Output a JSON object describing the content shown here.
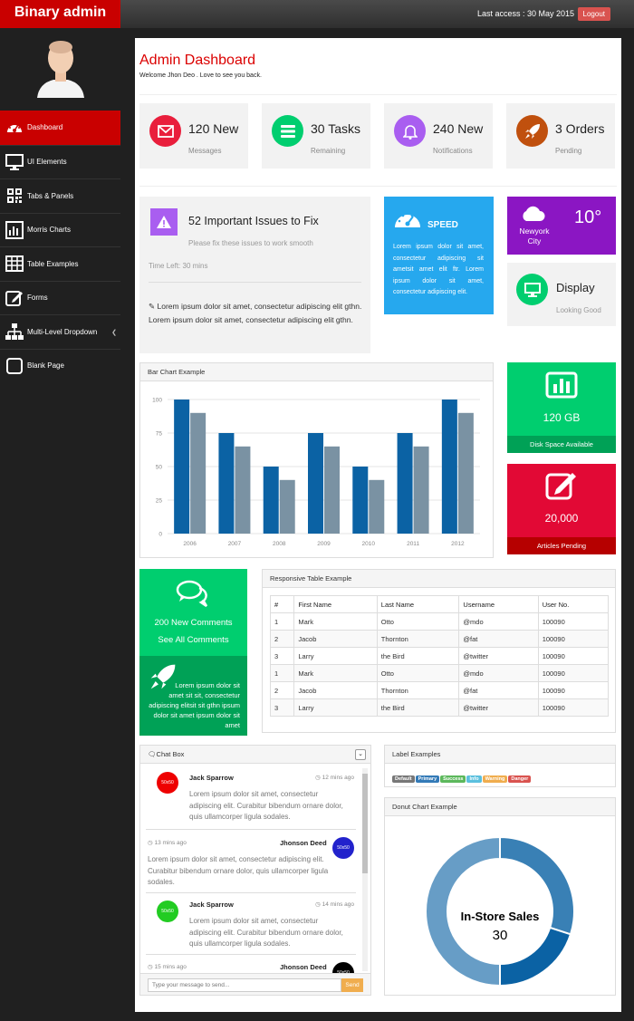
{
  "header": {
    "brand": "Binary admin",
    "last_access": "Last access : 30 May 2015",
    "logout_label": "Logout"
  },
  "sidebar": {
    "items": [
      {
        "label": "Dashboard",
        "icon": "dashboard-icon"
      },
      {
        "label": "UI Elements",
        "icon": "desktop-icon"
      },
      {
        "label": "Tabs & Panels",
        "icon": "qrcode-icon"
      },
      {
        "label": "Morris Charts",
        "icon": "bar-chart-icon"
      },
      {
        "label": "Table Examples",
        "icon": "table-icon"
      },
      {
        "label": "Forms",
        "icon": "edit-icon"
      },
      {
        "label": "Multi-Level Dropdown",
        "icon": "sitemap-icon"
      },
      {
        "label": "Blank Page",
        "icon": "square-icon"
      }
    ]
  },
  "page": {
    "title": "Admin Dashboard",
    "subtitle": "Welcome Jhon Deo . Love to see you back."
  },
  "stats": [
    {
      "value": "120 New",
      "label": "Messages",
      "color": "#e91e3c",
      "icon": "envelope-icon"
    },
    {
      "value": "30 Tasks",
      "label": "Remaining",
      "color": "#00ce6f",
      "icon": "bars-icon"
    },
    {
      "value": "240 New",
      "label": "Notifications",
      "color": "#a95ef0",
      "icon": "bell-icon"
    },
    {
      "value": "3 Orders",
      "label": "Pending",
      "color": "#c0500e",
      "icon": "rocket-icon"
    }
  ],
  "issues": {
    "title": "52 Important Issues to Fix",
    "subtitle": "Please fix these issues to work smooth",
    "time_left": "Time Left: 30 mins",
    "text": "Lorem ipsum dolor sit amet, consectetur adipiscing elit gthn. Lorem ipsum dolor sit amet, consectetur adipiscing elit gthn."
  },
  "speed": {
    "title": "SPEED",
    "text": "Lorem ipsum dolor sit amet, consectetur adipiscing sit ametsit amet elit ftr. Lorem ipsum dolor sit amet, consectetur adipiscing elit."
  },
  "weather": {
    "city": "Newyork City",
    "temp": "10°"
  },
  "display": {
    "title": "Display",
    "subtitle": "Looking Good"
  },
  "bar_panel": {
    "title": "Bar Chart Example"
  },
  "chart_data": {
    "type": "bar",
    "categories": [
      "2006",
      "2007",
      "2008",
      "2009",
      "2010",
      "2011",
      "2012"
    ],
    "series": [
      {
        "values": [
          100,
          75,
          50,
          75,
          50,
          75,
          100
        ],
        "color": "#0b62a4"
      },
      {
        "values": [
          90,
          65,
          40,
          65,
          40,
          65,
          90
        ],
        "color": "#7a92a3"
      }
    ],
    "yticks": [
      0,
      25,
      50,
      75,
      100
    ],
    "ylim": [
      0,
      100
    ],
    "grid": true
  },
  "disk": {
    "value": "120 GB",
    "label": "Disk Space Available"
  },
  "articles": {
    "value": "20,000",
    "label": "Articles Pending"
  },
  "comments": {
    "count": "200 New Comments",
    "link": "See All Comments",
    "text": "Lorem ipsum dolor sit amet sit sit, consectetur adipiscing elitsit sit gthn ipsum dolor sit amet ipsum dolor sit amet"
  },
  "table": {
    "title": "Responsive Table Example",
    "headers": [
      "#",
      "First Name",
      "Last Name",
      "Username",
      "User No."
    ],
    "rows": [
      [
        "1",
        "Mark",
        "Otto",
        "@mdo",
        "100090"
      ],
      [
        "2",
        "Jacob",
        "Thornton",
        "@fat",
        "100090"
      ],
      [
        "3",
        "Larry",
        "the Bird",
        "@twitter",
        "100090"
      ],
      [
        "1",
        "Mark",
        "Otto",
        "@mdo",
        "100090"
      ],
      [
        "2",
        "Jacob",
        "Thornton",
        "@fat",
        "100090"
      ],
      [
        "3",
        "Larry",
        "the Bird",
        "@twitter",
        "100090"
      ]
    ]
  },
  "chat": {
    "title": "Chat Box",
    "placeholder": "Type your message to send...",
    "send_label": "Send",
    "messages": [
      {
        "name": "Jack Sparrow",
        "time": "12 mins ago",
        "avatar": "50x50",
        "avatar_color": "#ee0000",
        "text": "Lorem ipsum dolor sit amet, consectetur adipiscing elit. Curabitur bibendum ornare dolor, quis ullamcorper ligula sodales."
      },
      {
        "name": "Jhonson Deed",
        "time": "13 mins ago",
        "avatar": "50x50",
        "avatar_color": "#2222cc",
        "text": "Lorem ipsum dolor sit amet, consectetur adipiscing elit. Curabitur bibendum ornare dolor, quis ullamcorper ligula sodales."
      },
      {
        "name": "Jack Sparrow",
        "time": "14 mins ago",
        "avatar": "50x50",
        "avatar_color": "#22cc22",
        "text": "Lorem ipsum dolor sit amet, consectetur adipiscing elit. Curabitur bibendum ornare dolor, quis ullamcorper ligula sodales."
      },
      {
        "name": "Jhonson Deed",
        "time": "15 mins ago",
        "avatar": "50x50",
        "avatar_color": "#000000",
        "text": ""
      }
    ]
  },
  "labels": {
    "title": "Label Examples",
    "items": [
      {
        "text": "Default",
        "color": "#777777"
      },
      {
        "text": "Primary",
        "color": "#337ab7"
      },
      {
        "text": "Success",
        "color": "#5cb85c"
      },
      {
        "text": "Info",
        "color": "#5bc0de"
      },
      {
        "text": "Warning",
        "color": "#f0ad4e"
      },
      {
        "text": "Danger",
        "color": "#d9534f"
      }
    ]
  },
  "donut": {
    "title": "Donut Chart Example",
    "label": "In-Store Sales",
    "value": "30",
    "segments": [
      {
        "value": 30,
        "color": "#3980b5"
      },
      {
        "value": 20,
        "color": "#0b62a4"
      },
      {
        "value": 50,
        "color": "#679dc6"
      }
    ]
  }
}
